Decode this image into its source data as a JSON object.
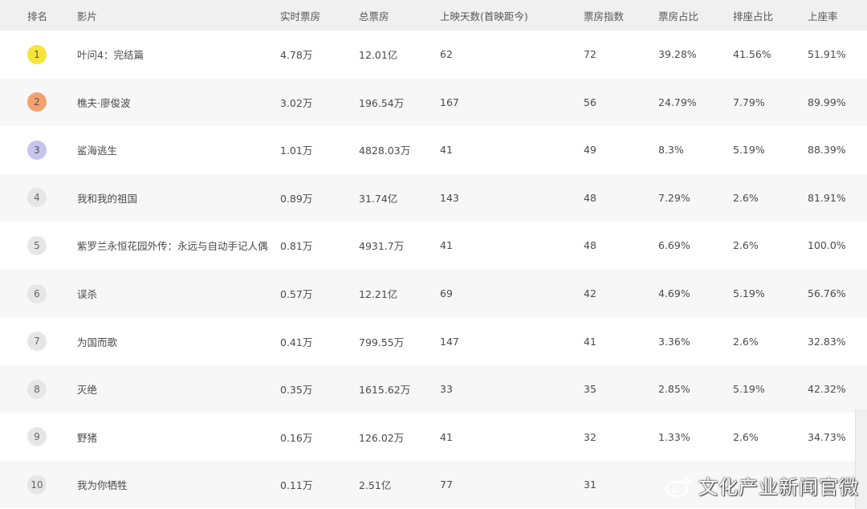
{
  "headers": {
    "rank": "排名",
    "film": "影片",
    "realtime": "实时票房",
    "total": "总票房",
    "days": "上映天数(首映距今)",
    "index": "票房指数",
    "ratio": "票房占比",
    "seat": "排座占比",
    "occupancy": "上座率"
  },
  "colors": {
    "rank1": "#f7e43a",
    "rank2": "#f2a16e",
    "rank3": "#c7c5ef",
    "rank_default": "#e6e6e6"
  },
  "rows": [
    {
      "rank": "1",
      "film": "叶问4：完结篇",
      "realtime": "4.78万",
      "total": "12.01亿",
      "days": "62",
      "index": "72",
      "ratio": "39.28%",
      "seat": "41.56%",
      "occupancy": "51.91%"
    },
    {
      "rank": "2",
      "film": "樵夫·廖俊波",
      "realtime": "3.02万",
      "total": "196.54万",
      "days": "167",
      "index": "56",
      "ratio": "24.79%",
      "seat": "7.79%",
      "occupancy": "89.99%"
    },
    {
      "rank": "3",
      "film": "鲨海逃生",
      "realtime": "1.01万",
      "total": "4828.03万",
      "days": "41",
      "index": "49",
      "ratio": "8.3%",
      "seat": "5.19%",
      "occupancy": "88.39%"
    },
    {
      "rank": "4",
      "film": "我和我的祖国",
      "realtime": "0.89万",
      "total": "31.74亿",
      "days": "143",
      "index": "48",
      "ratio": "7.29%",
      "seat": "2.6%",
      "occupancy": "81.91%"
    },
    {
      "rank": "5",
      "film": "紫罗兰永恒花园外传：永远与自动手记人偶",
      "realtime": "0.81万",
      "total": "4931.7万",
      "days": "41",
      "index": "48",
      "ratio": "6.69%",
      "seat": "2.6%",
      "occupancy": "100.0%"
    },
    {
      "rank": "6",
      "film": "误杀",
      "realtime": "0.57万",
      "total": "12.21亿",
      "days": "69",
      "index": "42",
      "ratio": "4.69%",
      "seat": "5.19%",
      "occupancy": "56.76%"
    },
    {
      "rank": "7",
      "film": "为国而歌",
      "realtime": "0.41万",
      "total": "799.55万",
      "days": "147",
      "index": "41",
      "ratio": "3.36%",
      "seat": "2.6%",
      "occupancy": "32.83%"
    },
    {
      "rank": "8",
      "film": "灭绝",
      "realtime": "0.35万",
      "total": "1615.62万",
      "days": "33",
      "index": "35",
      "ratio": "2.85%",
      "seat": "5.19%",
      "occupancy": "42.32%"
    },
    {
      "rank": "9",
      "film": "野猪",
      "realtime": "0.16万",
      "total": "126.02万",
      "days": "41",
      "index": "32",
      "ratio": "1.33%",
      "seat": "2.6%",
      "occupancy": "34.73%"
    },
    {
      "rank": "10",
      "film": "我为你牺牲",
      "realtime": "0.11万",
      "total": "2.51亿",
      "days": "77",
      "index": "31",
      "ratio": "",
      "seat": "",
      "occupancy": ""
    }
  ],
  "watermark": {
    "text": "文化产业新闻官微",
    "icon": "weibo-icon"
  }
}
